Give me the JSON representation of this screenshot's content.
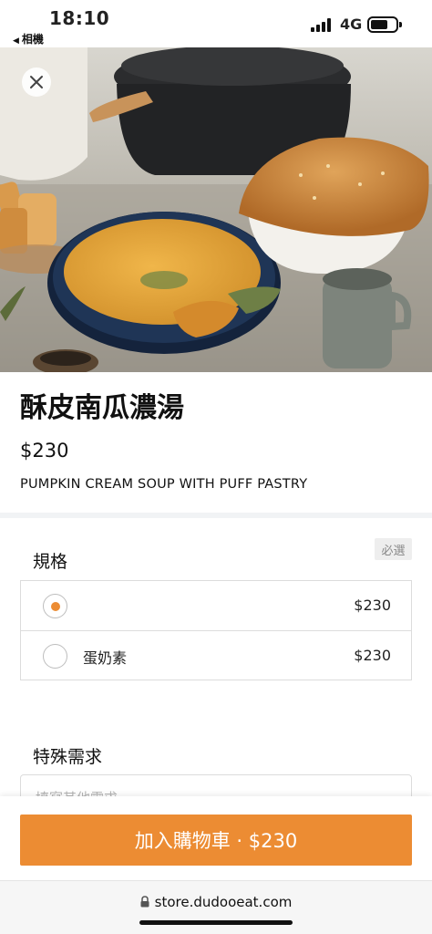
{
  "status_bar": {
    "time": "18:10",
    "back_app": "相機",
    "network": "4G"
  },
  "hero": {
    "close_icon": "close-icon",
    "image_subject": "pumpkin-soup-photo"
  },
  "product": {
    "title": "酥皮南瓜濃湯",
    "price": "$230",
    "subtitle": "PUMPKIN CREAM SOUP WITH PUFF PASTRY"
  },
  "options": {
    "heading": "規格",
    "required_badge": "必選",
    "items": [
      {
        "name": "",
        "price": "$230",
        "selected": true
      },
      {
        "name": "蛋奶素",
        "price": "$230",
        "selected": false
      }
    ]
  },
  "special_request": {
    "heading": "特殊需求",
    "placeholder": "填寫其他需求",
    "value": ""
  },
  "cart": {
    "button_label": "加入購物車 · $230"
  },
  "browser": {
    "url": "store.dudooeat.com"
  },
  "colors": {
    "accent": "#ec8c33",
    "divider": "#f1f3f5",
    "soup": "#e2a33c",
    "bowl": "#1c2f4d"
  }
}
